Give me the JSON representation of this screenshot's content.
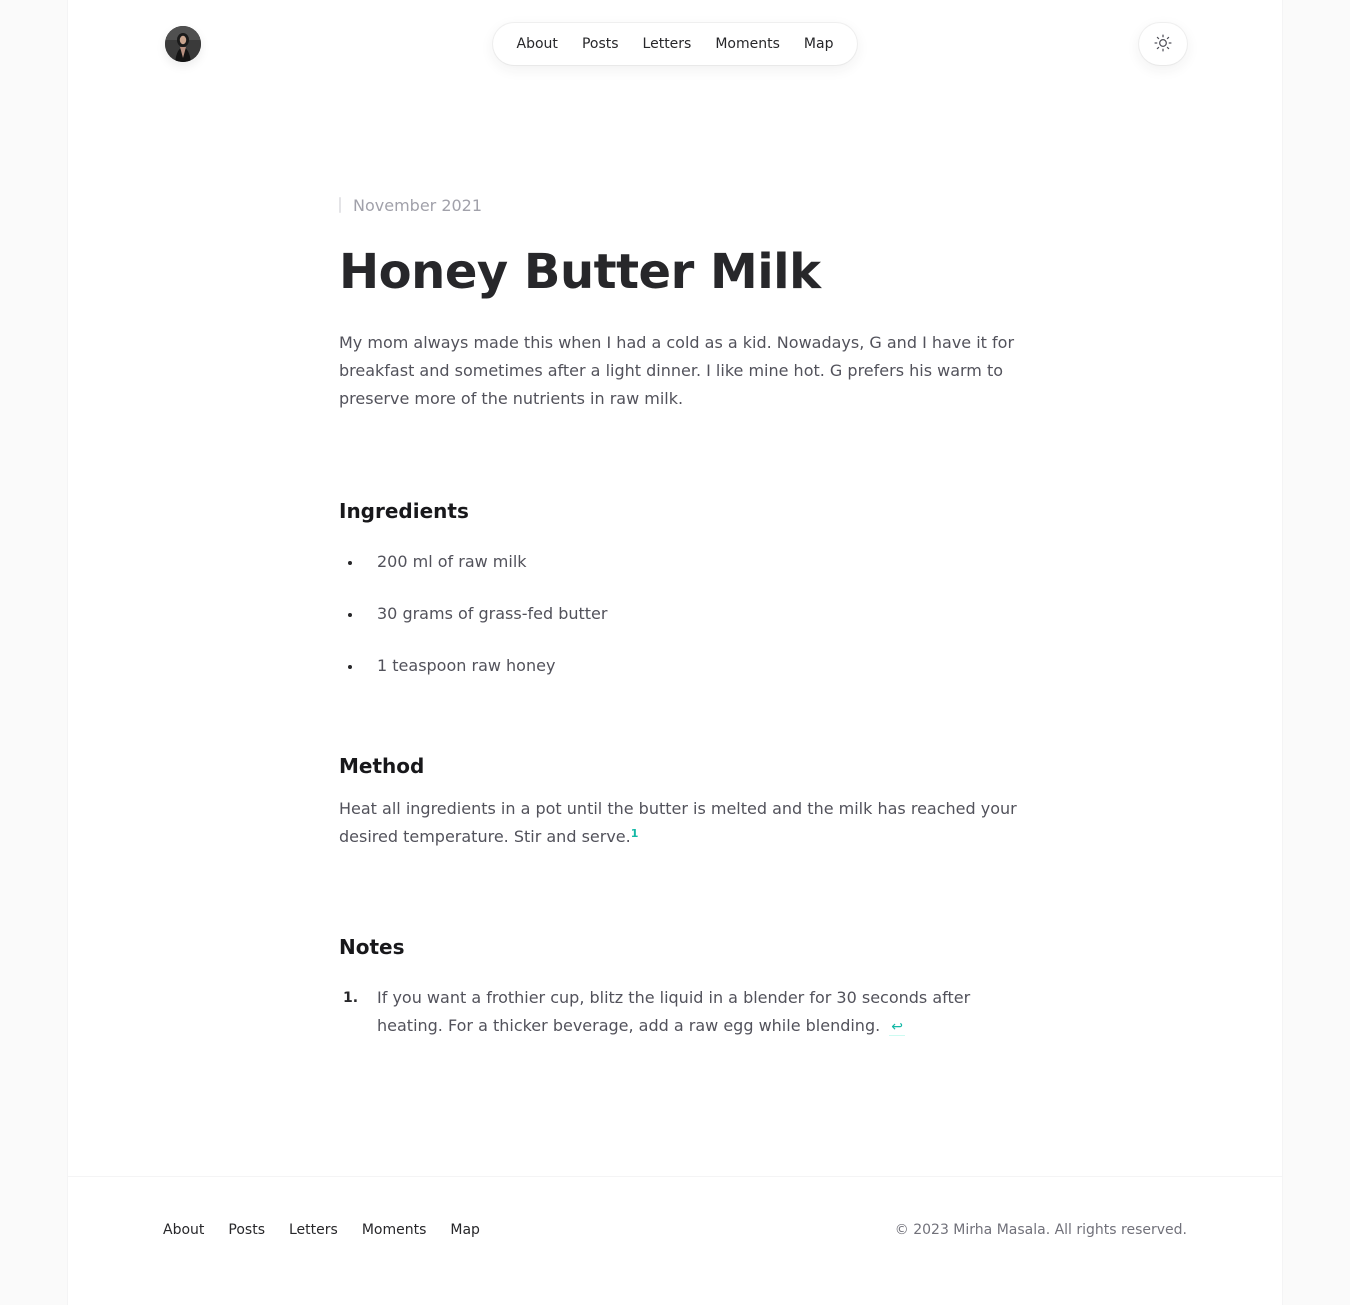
{
  "header": {
    "avatar_alt": "",
    "nav": [
      "About",
      "Posts",
      "Letters",
      "Moments",
      "Map"
    ],
    "theme_icon": "sun-icon"
  },
  "article": {
    "date": "November 2021",
    "title": "Honey Butter Milk",
    "intro": "My mom always made this when I had a cold as a kid. Nowadays, G and I have it for breakfast and sometimes after a light dinner. I like mine hot. G prefers his warm to preserve more of the nutrients in raw milk.",
    "ingredients_heading": "Ingredients",
    "ingredients": [
      "200 ml of raw milk",
      "30 grams of grass-fed butter",
      "1 teaspoon raw honey"
    ],
    "method_heading": "Method",
    "method_text": "Heat all ingredients in a pot until the butter is melted and the milk has reached your desired temperature. Stir and serve.",
    "method_footnote_ref": "1",
    "notes_heading": "Notes",
    "notes": [
      {
        "number": "1.",
        "text": "If you want a frothier cup, blitz the liquid in a blender for 30 seconds after heating. For a thicker beverage, add a raw egg while blending.",
        "backref": "↩"
      }
    ]
  },
  "footer": {
    "nav": [
      "About",
      "Posts",
      "Letters",
      "Moments",
      "Map"
    ],
    "copyright": "© 2023 Mirha Masala. All rights reserved."
  },
  "colors": {
    "accent": "#14b8a6",
    "heading": "#27272a",
    "body_text": "#52525b",
    "muted": "#a1a1aa"
  }
}
